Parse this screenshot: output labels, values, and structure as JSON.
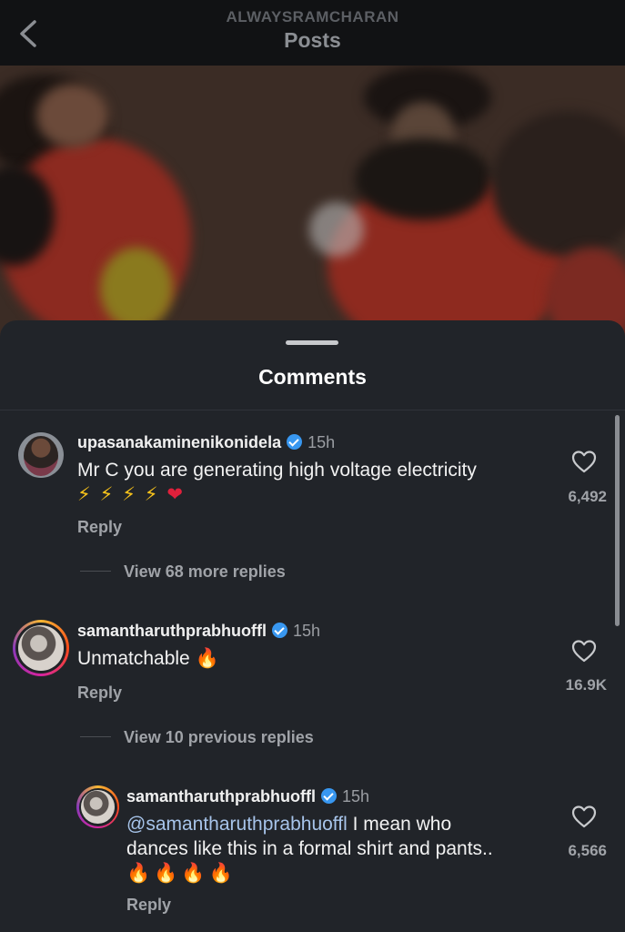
{
  "header": {
    "account": "ALWAYSRAMCHARAN",
    "title": "Posts"
  },
  "sheet": {
    "title": "Comments"
  },
  "comments": [
    {
      "username": "upasanakaminenikonidela",
      "verified": true,
      "time": "15h",
      "text_line1": "Mr C you are generating high voltage electricity",
      "text_line2": "⚡ ⚡ ⚡ ⚡ ❤",
      "reply_label": "Reply",
      "likes": "6,492",
      "view_replies": "View 68 more replies"
    },
    {
      "username": "samantharuthprabhuoffl",
      "verified": true,
      "time": "15h",
      "text_line1": "Unmatchable 🔥",
      "reply_label": "Reply",
      "likes": "16.9K",
      "view_replies": "View 10 previous replies"
    }
  ],
  "reply": {
    "username": "samantharuthprabhuoffl",
    "verified": true,
    "time": "15h",
    "mention": "@samantharuthprabhuoffl",
    "text_line1_rest": " I mean who",
    "text_line2": "dances like this in a formal shirt and pants..",
    "text_line3": "🔥🔥🔥🔥",
    "reply_label": "Reply",
    "likes": "6,566"
  },
  "colors": {
    "verified": "#3897f0",
    "mention": "#a7c4ea",
    "sheet_bg": "#212429"
  },
  "icons": [
    "back-chevron-icon",
    "verified-badge-icon",
    "heart-outline-icon"
  ]
}
